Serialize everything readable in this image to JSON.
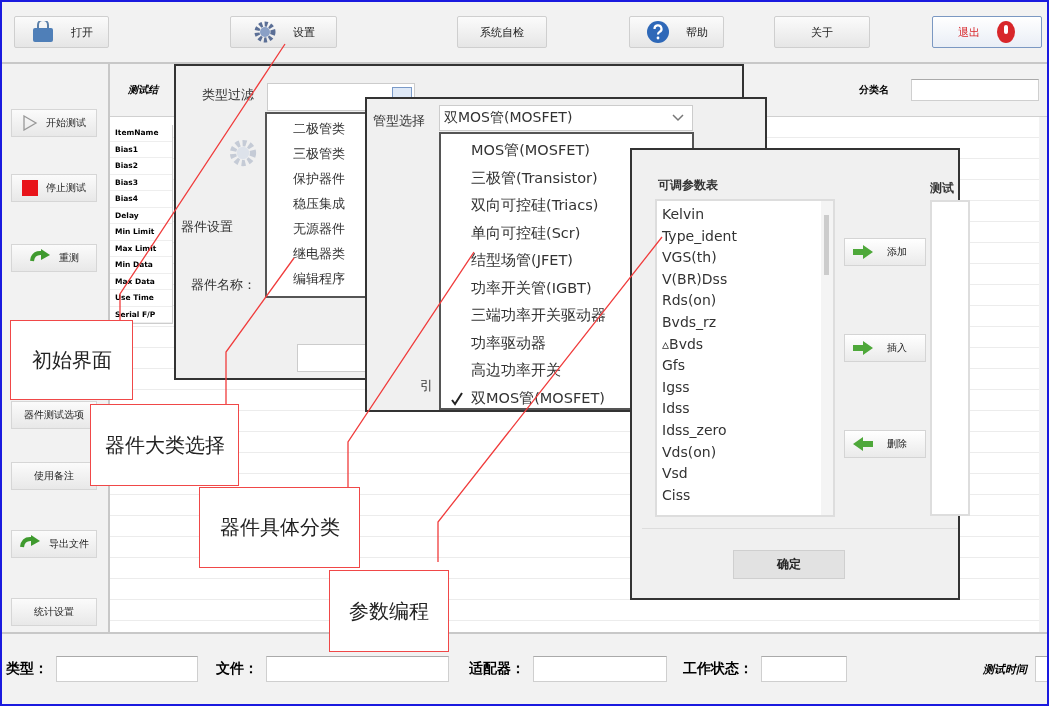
{
  "toolbar": [
    {
      "label": "打开",
      "kind": "open"
    },
    {
      "label": "设置",
      "kind": "settings"
    },
    {
      "label": "系统自检",
      "kind": "plain"
    },
    {
      "label": "帮助",
      "kind": "help"
    },
    {
      "label": "关于",
      "kind": "plain"
    },
    {
      "label": "退出",
      "kind": "exit"
    }
  ],
  "sidebar": [
    {
      "label": "开始测试",
      "kind": "play"
    },
    {
      "label": "停止测试",
      "kind": "stop"
    },
    {
      "label": "重测",
      "kind": "redo"
    },
    {
      "label": "器件测试选项",
      "kind": "plain"
    },
    {
      "label": "使用备注",
      "kind": "plain"
    },
    {
      "label": "导出文件",
      "kind": "export"
    },
    {
      "label": "统计设置",
      "kind": "plain"
    }
  ],
  "results": {
    "title": "测试结",
    "class_label": "分类名",
    "rows": [
      "ItemName",
      "Bias1",
      "Bias2",
      "Bias3",
      "Bias4",
      "Delay",
      "Min Limit",
      "Max Limit",
      "Min Data",
      "Max Data",
      "Use Time",
      "Serial  F/P"
    ]
  },
  "status_bar": [
    {
      "label": "类型：",
      "kind": "plain"
    },
    {
      "label": "文件：",
      "kind": "plain"
    },
    {
      "label": "适配器：",
      "kind": "plain"
    },
    {
      "label": "工作状态：",
      "kind": "plain"
    },
    {
      "label": "测试时间",
      "kind": "small"
    }
  ],
  "filter_dialog": {
    "label": "类型过滤",
    "section": "器件设置",
    "name_label": "器件名称：",
    "options": [
      "二极管类",
      "三极管类",
      "保护器件",
      "稳压集成",
      "无源器件",
      "继电器类",
      "编辑程序"
    ]
  },
  "type_dialog": {
    "label": "管型选择",
    "value": "双MOS管(MOSFET)",
    "cut_label": "引",
    "options": [
      {
        "label": "MOS管(MOSFET)",
        "selected": false
      },
      {
        "label": "三极管(Transistor)",
        "selected": false
      },
      {
        "label": "双向可控硅(Triacs)",
        "selected": false
      },
      {
        "label": "单向可控硅(Scr)",
        "selected": false
      },
      {
        "label": "结型场管(JFET)",
        "selected": false
      },
      {
        "label": "功率开关管(IGBT)",
        "selected": false
      },
      {
        "label": "三端功率开关驱动器",
        "selected": false
      },
      {
        "label": "功率驱动器",
        "selected": false
      },
      {
        "label": "高边功率开关",
        "selected": false
      },
      {
        "label": "双MOS管(MOSFET)",
        "selected": true
      }
    ]
  },
  "param_dialog": {
    "list_title": "可调参数表",
    "items": [
      "Kelvin",
      "Type_ident",
      "VGS(th)",
      "V(BR)Dss",
      "Rds(on)",
      "Bvds_rz",
      "▵Bvds",
      "Gfs",
      "Igss",
      "Idss",
      "Idss_zero",
      "Vds(on)",
      "Vsd",
      "Ciss"
    ],
    "buttons": [
      {
        "label": "添加",
        "kind": "right"
      },
      {
        "label": "插入",
        "kind": "right"
      },
      {
        "label": "删除",
        "kind": "left"
      }
    ],
    "right_title": "测试",
    "ok": "确定"
  },
  "annotations": [
    "初始界面",
    "器件大类选择",
    "器件具体分类",
    "参数编程"
  ]
}
